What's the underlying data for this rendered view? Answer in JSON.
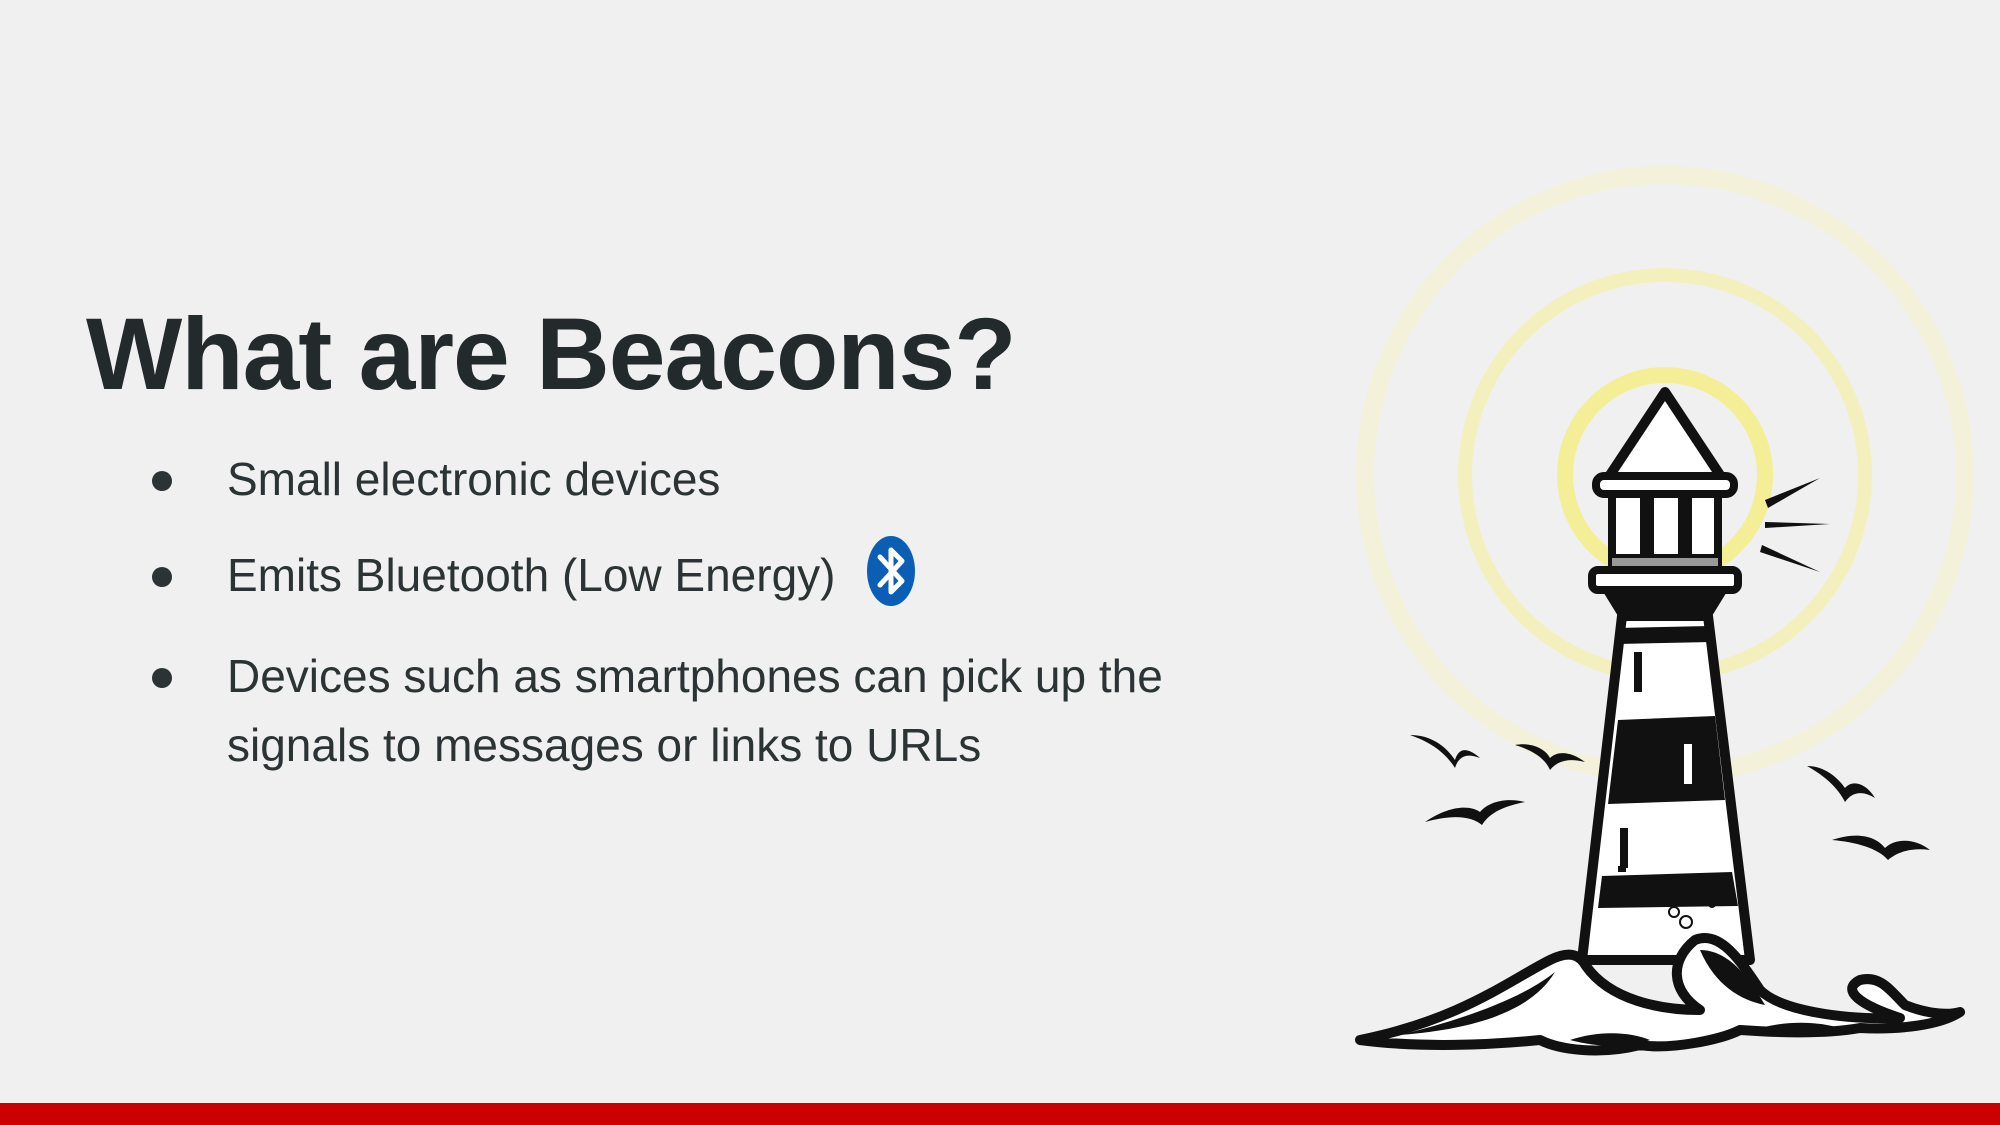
{
  "slide": {
    "title": "What are Beacons?",
    "bullets": [
      {
        "text": "Small electronic devices"
      },
      {
        "text": "Emits Bluetooth (Low Energy)",
        "icon": "bluetooth-icon"
      },
      {
        "text": "Devices such as smartphones can pick up the signals to messages or links to URLs"
      }
    ],
    "illustration": "lighthouse-icon"
  },
  "colors": {
    "background": "#f0f0f0",
    "title": "#222a2b",
    "text": "#2c3334",
    "accent_bar": "#cc0000",
    "bluetooth": "#0a5fb4",
    "glow": "#f7f29a"
  }
}
